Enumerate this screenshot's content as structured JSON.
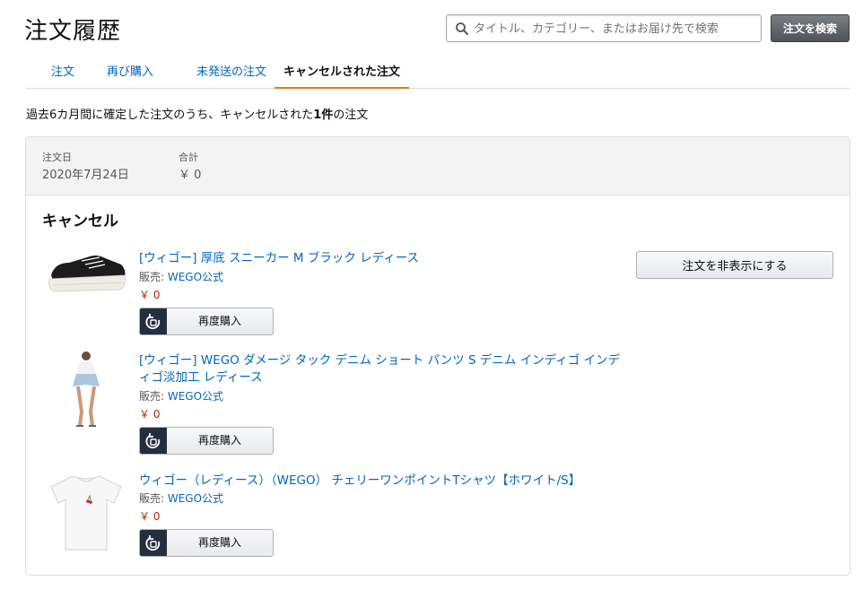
{
  "header": {
    "title": "注文履歴",
    "search_placeholder": "タイトル、カテゴリー、またはお届け先で検索",
    "search_value": "",
    "search_button": "注文を検索"
  },
  "tabs": [
    {
      "label": "注文",
      "active": false
    },
    {
      "label": "再び購入",
      "active": false
    },
    {
      "label": "未発送の注文",
      "active": false
    },
    {
      "label": "キャンセルされた注文",
      "active": true
    }
  ],
  "summary": {
    "prefix": "過去6カ月間に確定した注文のうち、キャンセルされた",
    "count": "1件",
    "suffix": "の注文"
  },
  "order": {
    "date_label": "注文日",
    "date_value": "2020年7月24日",
    "total_label": "合計",
    "total_value": "￥ 0",
    "status": "キャンセル",
    "hide_button": "注文を非表示にする",
    "items": [
      {
        "title": "[ウィゴー] 厚底 スニーカー M ブラック レディース",
        "seller_prefix": "販売: ",
        "seller_name": "WEGO公式",
        "price": "￥ 0",
        "rebuy_label": "再度購入",
        "image_icon": "sneaker-image"
      },
      {
        "title_line1": "[ウィゴー] WEGO ダメージ タック デニム ショート パンツ S デニム インディゴ インデ",
        "title_line2": "ィゴ淡加工 レディース",
        "seller_prefix": "販売: ",
        "seller_name": "WEGO公式",
        "price": "￥ 0",
        "rebuy_label": "再度購入",
        "image_icon": "denim-shorts-image"
      },
      {
        "title": "ウィゴー（レディース）（WEGO） チェリーワンポイントTシャツ【ホワイト/S】",
        "seller_prefix": "販売: ",
        "seller_name": "WEGO公式",
        "price": "￥ 0",
        "rebuy_label": "再度購入",
        "image_icon": "tshirt-image"
      }
    ]
  },
  "colors": {
    "link": "#0066c0",
    "price": "#b12704",
    "tab_active_underline": "#e47911",
    "header_bg": "#f3f3f3",
    "search_button_bg": "#5a5e64"
  },
  "icons": {
    "search": "search-icon",
    "rebuy": "rebuy-icon"
  }
}
